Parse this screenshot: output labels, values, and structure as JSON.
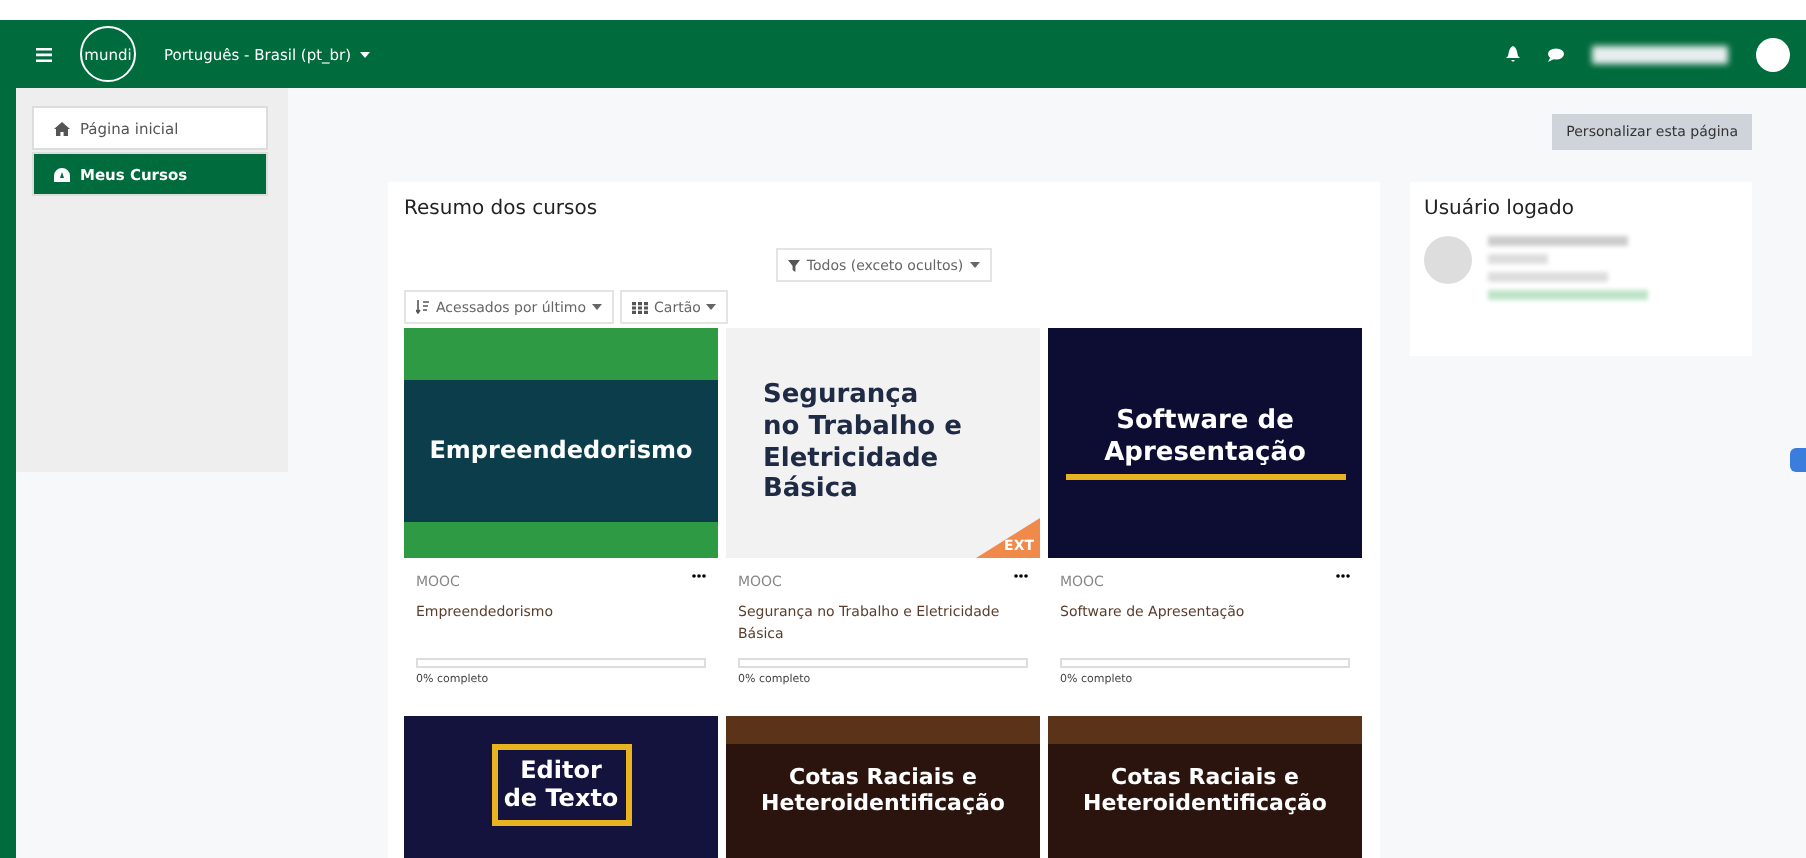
{
  "header": {
    "logo": "mundi",
    "language": "Português - Brasil (pt_br)"
  },
  "nav": [
    {
      "label": "Página inicial",
      "selected": false
    },
    {
      "label": "Meus Cursos",
      "selected": true
    }
  ],
  "customize_button": "Personalizar esta página",
  "courses_block": {
    "title": "Resumo dos cursos",
    "filter": "Todos (exceto ocultos)",
    "sort": "Acessados por último",
    "view": "Cartão",
    "cards": [
      {
        "banner": {
          "kind": "green",
          "title": "Empreendedorismo"
        },
        "category": "MOOC",
        "name": "Empreendedorismo",
        "level": 0,
        "progress_text": "0% completo"
      },
      {
        "banner": {
          "kind": "light",
          "title": "Segurança no Trabalho e Eletricidade Básica",
          "tag": "EXT"
        },
        "category": "MOOC",
        "name": "Segurança no Trabalho e Eletricidade Básica",
        "level": 0,
        "progress_text": "0% completo"
      },
      {
        "banner": {
          "kind": "navy",
          "title": "Software de Apresentação"
        },
        "category": "MOOC",
        "name": "Software de Apresentação",
        "level": 0,
        "progress_text": "0% completo"
      },
      {
        "banner": {
          "kind": "purple",
          "title": "Editor de Texto"
        }
      },
      {
        "banner": {
          "kind": "brown",
          "title": "Cotas Raciais e Heteroidentificação"
        }
      },
      {
        "banner": {
          "kind": "brown",
          "title": "Cotas Raciais e Heteroidentificação"
        }
      }
    ]
  },
  "user_block": {
    "title": "Usuário logado"
  }
}
